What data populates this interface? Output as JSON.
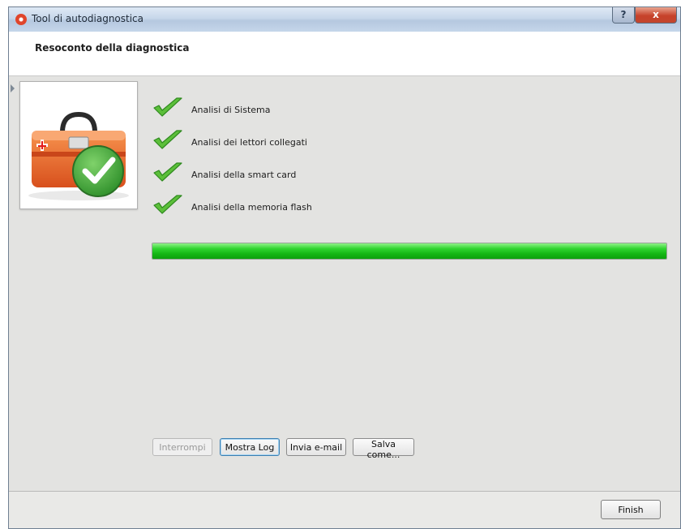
{
  "window": {
    "title": "Tool di autodiagnostica",
    "controls": {
      "help": "?",
      "close": "x"
    }
  },
  "header": {
    "title": "Resoconto della diagnostica"
  },
  "image": {
    "icon": "first-aid-toolbox-with-checkmark-icon"
  },
  "checks": [
    {
      "label": "Analisi di Sistema",
      "icon": "green-checkmark-icon"
    },
    {
      "label": "Analisi dei lettori collegati",
      "icon": "green-checkmark-icon"
    },
    {
      "label": "Analisi della smart card",
      "icon": "green-checkmark-icon"
    },
    {
      "label": "Analisi della memoria flash",
      "icon": "green-checkmark-icon"
    }
  ],
  "progress": {
    "value": 1.0
  },
  "buttons": {
    "interrompi": "Interrompi",
    "mostra_log": "Mostra Log",
    "invia_email": "Invia e-mail",
    "salva_come": "Salva come...",
    "finish": "Finish"
  },
  "colors": {
    "progress_fill": "#1fc21f",
    "title_bar": "#c7d7ea",
    "close_button": "#c6412a",
    "toolbox": "#ee6a2c"
  }
}
